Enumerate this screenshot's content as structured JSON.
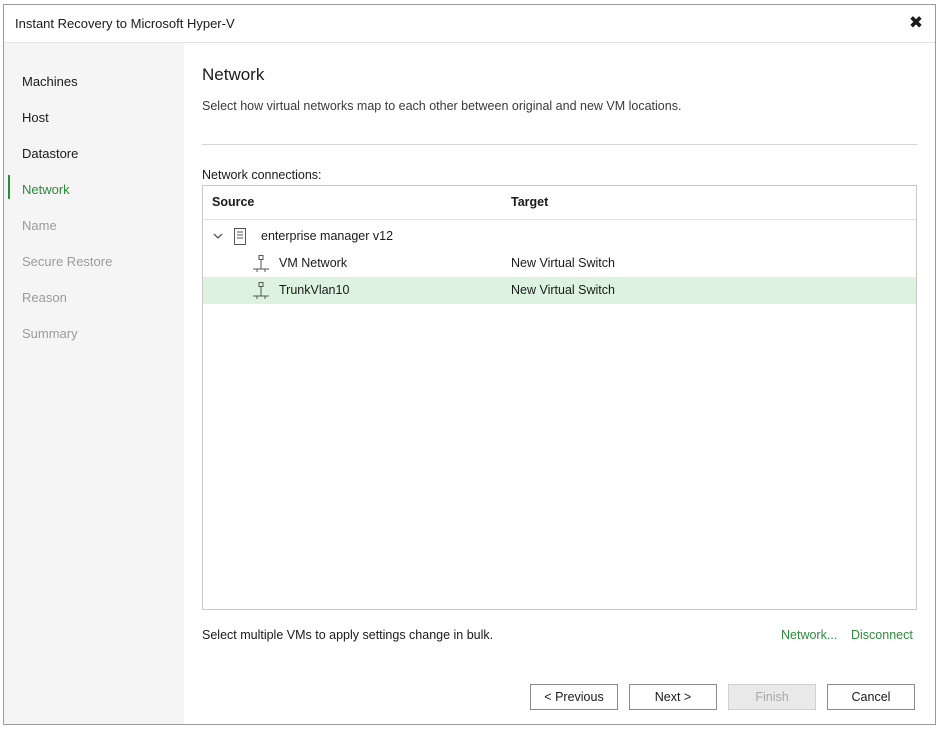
{
  "window": {
    "title": "Instant Recovery to Microsoft Hyper-V",
    "close_glyph": "✖"
  },
  "sidebar": {
    "steps": [
      {
        "label": "Machines",
        "state": "done"
      },
      {
        "label": "Host",
        "state": "done"
      },
      {
        "label": "Datastore",
        "state": "done"
      },
      {
        "label": "Network",
        "state": "current"
      },
      {
        "label": "Name",
        "state": "future"
      },
      {
        "label": "Secure Restore",
        "state": "future"
      },
      {
        "label": "Reason",
        "state": "future"
      },
      {
        "label": "Summary",
        "state": "future"
      }
    ]
  },
  "page": {
    "title": "Network",
    "description": "Select how virtual networks map to each other between original and new VM locations.",
    "connections_label": "Network connections:"
  },
  "grid": {
    "columns": [
      "Source",
      "Target"
    ],
    "vm": {
      "name": "enterprise manager v12",
      "expanded": true,
      "networks": [
        {
          "source": "VM Network",
          "target": "New Virtual Switch",
          "selected": false
        },
        {
          "source": "TrunkVlan10",
          "target": "New Virtual Switch",
          "selected": true
        }
      ]
    }
  },
  "footer": {
    "bulk_hint": "Select multiple VMs to apply settings change in bulk.",
    "network_link": "Network...",
    "disconnect_link": "Disconnect"
  },
  "buttons": {
    "previous": "< Previous",
    "next": "Next >",
    "finish": "Finish",
    "cancel": "Cancel"
  },
  "colors": {
    "accent": "#2e8b3d",
    "selected_row": "#ddf3df",
    "sidebar_bg": "#f5f5f5"
  }
}
